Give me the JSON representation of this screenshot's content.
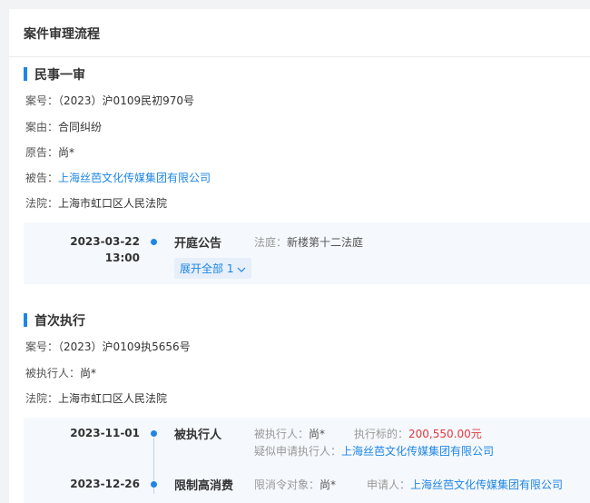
{
  "page_title": "案件审理流程",
  "first_trial": {
    "title": "民事一审",
    "case_no_label": "案号：",
    "case_no": "（2023）沪0109民初970号",
    "cause_label": "案由：",
    "cause": "合同纠纷",
    "plaintiff_label": "原告：",
    "plaintiff": "尚*",
    "defendant_label": "被告：",
    "defendant": "上海丝芭文化传媒集团有限公司",
    "court_label": "法院：",
    "court": "上海市虹口区人民法院",
    "timeline": [
      {
        "date": "2023-03-22",
        "time": "13:00",
        "event": "开庭公告",
        "detail_label": "法庭：",
        "detail_value": "新楼第十二法庭",
        "expand_label": "展开全部 1"
      }
    ]
  },
  "first_execution": {
    "title": "首次执行",
    "case_no_label": "案号：",
    "case_no": "（2023）沪0109执5656号",
    "executed_label": "被执行人：",
    "executed": "尚*",
    "court_label": "法院：",
    "court": "上海市虹口区人民法院",
    "timeline": [
      {
        "date": "2023-11-01",
        "event": "被执行人",
        "executed_label": "被执行人：",
        "executed": "尚*",
        "target_label": "执行标的：",
        "target_value": "200,550.00元",
        "applicant_label": "疑似申请执行人：",
        "applicant": "上海丝芭文化传媒集团有限公司"
      },
      {
        "date": "2023-12-26",
        "event": "限制高消费",
        "subject_label": "限消令对象：",
        "subject": "尚*",
        "applicant_label": "申请人：",
        "applicant": "上海丝芭文化传媒集团有限公司"
      }
    ]
  },
  "colors": {
    "accent": "#1e86e5",
    "amount": "#e4393c",
    "timeline_bg": "#f5f8fc"
  }
}
